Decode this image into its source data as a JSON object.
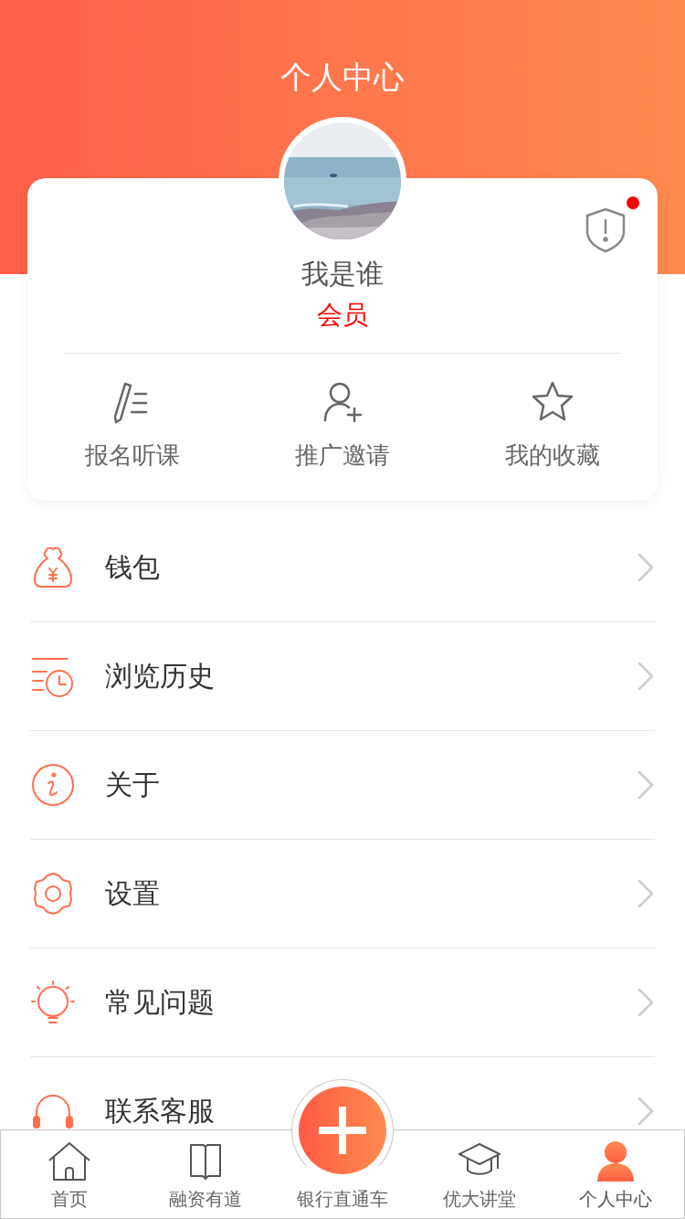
{
  "header": {
    "title": "个人中心"
  },
  "profile": {
    "name": "我是谁",
    "badge": "会员",
    "alert": true
  },
  "actions": [
    {
      "kind": "enroll",
      "label": "报名听课"
    },
    {
      "kind": "invite",
      "label": "推广邀请"
    },
    {
      "kind": "favorite",
      "label": "我的收藏"
    }
  ],
  "menu": [
    {
      "kind": "wallet",
      "label": "钱包"
    },
    {
      "kind": "history",
      "label": "浏览历史"
    },
    {
      "kind": "about",
      "label": "关于"
    },
    {
      "kind": "settings",
      "label": "设置"
    },
    {
      "kind": "faq",
      "label": "常见问题"
    },
    {
      "kind": "service",
      "label": "联系客服"
    }
  ],
  "tabbar": [
    {
      "kind": "home",
      "label": "首页",
      "selected": false
    },
    {
      "kind": "book",
      "label": "融资有道",
      "selected": false
    },
    {
      "kind": "plus",
      "label": "银行直通车",
      "selected": false
    },
    {
      "kind": "cap",
      "label": "优大讲堂",
      "selected": false
    },
    {
      "kind": "person",
      "label": "个人中心",
      "selected": true
    }
  ]
}
